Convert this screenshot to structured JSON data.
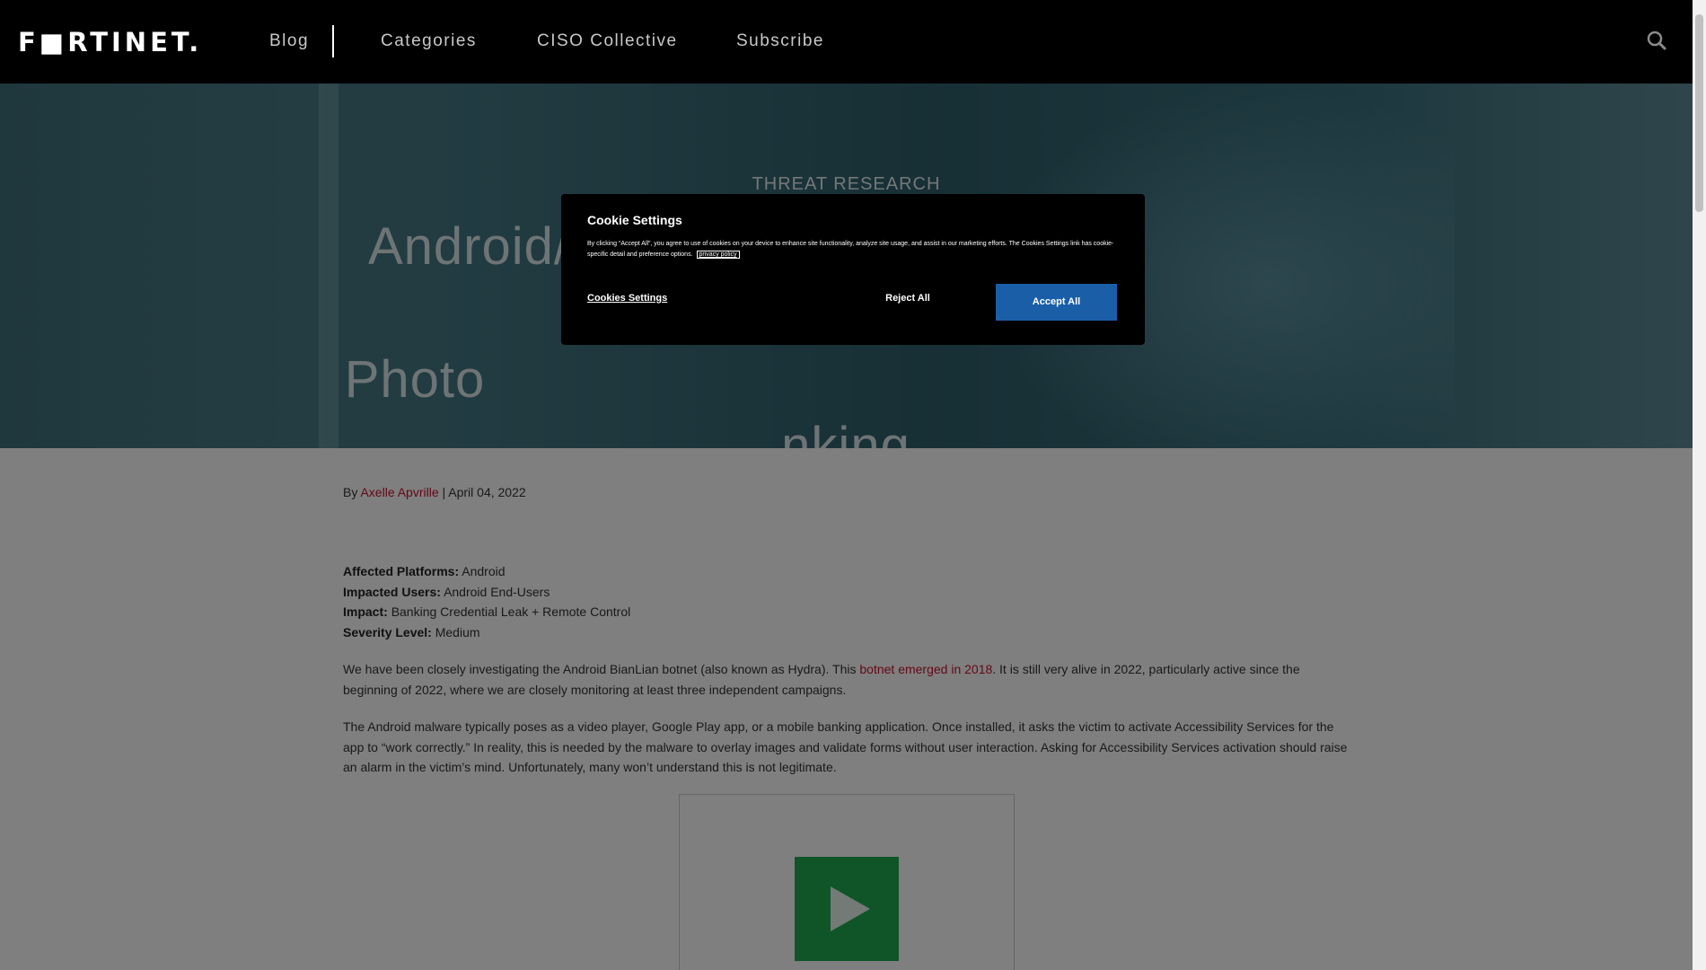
{
  "header": {
    "logo": "F■RTINET.",
    "nav": [
      "Blog",
      "Categories",
      "CISO Collective",
      "Subscribe"
    ]
  },
  "hero": {
    "category": "THREAT RESEARCH",
    "title_line1": "Android/                            Bypass",
    "title_line2": "Photo                                nking"
  },
  "article": {
    "by": "By",
    "author": "Axelle Apvrille",
    "date": "| April 04, 2022",
    "meta": [
      {
        "label": "Affected Platforms:",
        "value": "Android"
      },
      {
        "label": "Impacted Users:",
        "value": "Android End-Users"
      },
      {
        "label": "Impact:",
        "value": "Banking Credential Leak + Remote Control"
      },
      {
        "label": "Severity Level:",
        "value": "Medium"
      }
    ],
    "para1_a": "We have been closely investigating the Android BianLian botnet (also known as Hydra). This ",
    "para1_link": "botnet emerged in 2018",
    "para1_b": ". It is still very alive in 2022, particularly active since the beginning of 2022, where we are closely monitoring at least three independent campaigns.",
    "para2": "The Android malware typically poses as a video player, Google Play app, or a mobile banking application. Once installed, it asks the victim to activate Accessibility Services for the app to “work correctly.” In reality, this is needed by the malware to overlay images and validate forms without user interaction. Asking for Accessibility Services activation should raise an alarm in the victim’s mind. Unfortunately, many won’t understand this is not legitimate."
  },
  "cookie": {
    "title": "Cookie Settings",
    "text": "By clicking “Accept All”, you agree to use of cookies on your device to enhance site functionality, analyze site usage, and assist in our marketing efforts. The Cookies Settings link has cookie-specific detail and preference options.",
    "privacy_link": "privacy policy",
    "settings_button": "Cookies Settings",
    "reject_button": "Reject All",
    "accept_button": "Accept All"
  },
  "icons": {
    "search": "search-icon",
    "play": "play-icon"
  },
  "colors": {
    "link": "#c8102e",
    "accept": "#1a5ea8",
    "play": "#1faa50"
  }
}
